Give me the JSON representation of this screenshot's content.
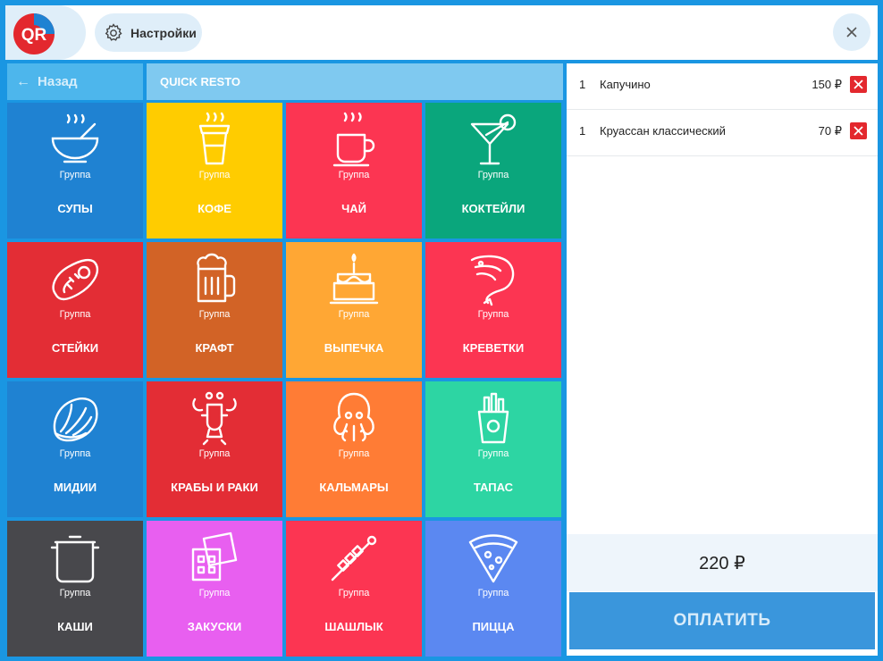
{
  "header": {
    "logo_text": "QR",
    "settings_label": "Настройки"
  },
  "nav": {
    "back_label": "Назад",
    "breadcrumb": "QUICK RESTO"
  },
  "tiles": [
    {
      "name": "СУПЫ",
      "sub": "Группа",
      "color": "#1f82d2",
      "icon": "soup-icon"
    },
    {
      "name": "КОФЕ",
      "sub": "Группа",
      "color": "#ffcc00",
      "icon": "coffee-icon"
    },
    {
      "name": "ЧАЙ",
      "sub": "Группа",
      "color": "#fc3552",
      "icon": "tea-icon"
    },
    {
      "name": "КОКТЕЙЛИ",
      "sub": "Группа",
      "color": "#0aa67c",
      "icon": "cocktail-icon"
    },
    {
      "name": "СТЕЙКИ",
      "sub": "Группа",
      "color": "#e32d35",
      "icon": "steak-icon"
    },
    {
      "name": "КРАФТ",
      "sub": "Группа",
      "color": "#d26326",
      "icon": "beer-icon"
    },
    {
      "name": "ВЫПЕЧКА",
      "sub": "Группа",
      "color": "#ffa734",
      "icon": "cake-icon"
    },
    {
      "name": "КРЕВЕТКИ",
      "sub": "Группа",
      "color": "#fc3552",
      "icon": "shrimp-icon"
    },
    {
      "name": "МИДИИ",
      "sub": "Группа",
      "color": "#1f82d2",
      "icon": "mussel-icon"
    },
    {
      "name": "КРАБЫ И РАКИ",
      "sub": "Группа",
      "color": "#e32d35",
      "icon": "lobster-icon"
    },
    {
      "name": "КАЛЬМАРЫ",
      "sub": "Группа",
      "color": "#ff7c35",
      "icon": "octopus-icon"
    },
    {
      "name": "ТАПАС",
      "sub": "Группа",
      "color": "#2dd5a3",
      "icon": "fries-icon"
    },
    {
      "name": "КАШИ",
      "sub": "Группа",
      "color": "#48484c",
      "icon": "pot-icon"
    },
    {
      "name": "ЗАКУСКИ",
      "sub": "Группа",
      "color": "#e85ff0",
      "icon": "snacks-icon"
    },
    {
      "name": "ШАШЛЫК",
      "sub": "Группа",
      "color": "#fc3552",
      "icon": "skewer-icon"
    },
    {
      "name": "ПИЦЦА",
      "sub": "Группа",
      "color": "#5b88f1",
      "icon": "pizza-icon"
    }
  ],
  "order": {
    "items": [
      {
        "qty": "1",
        "name": "Капучино",
        "price": "150 ₽"
      },
      {
        "qty": "1",
        "name": "Круассан классический",
        "price": "70 ₽"
      }
    ],
    "total": "220 ₽",
    "pay_label": "ОПЛАТИТЬ"
  },
  "colors": {
    "accent": "#1a96e2",
    "pay": "#3a96dc",
    "delete": "#e3282e"
  }
}
